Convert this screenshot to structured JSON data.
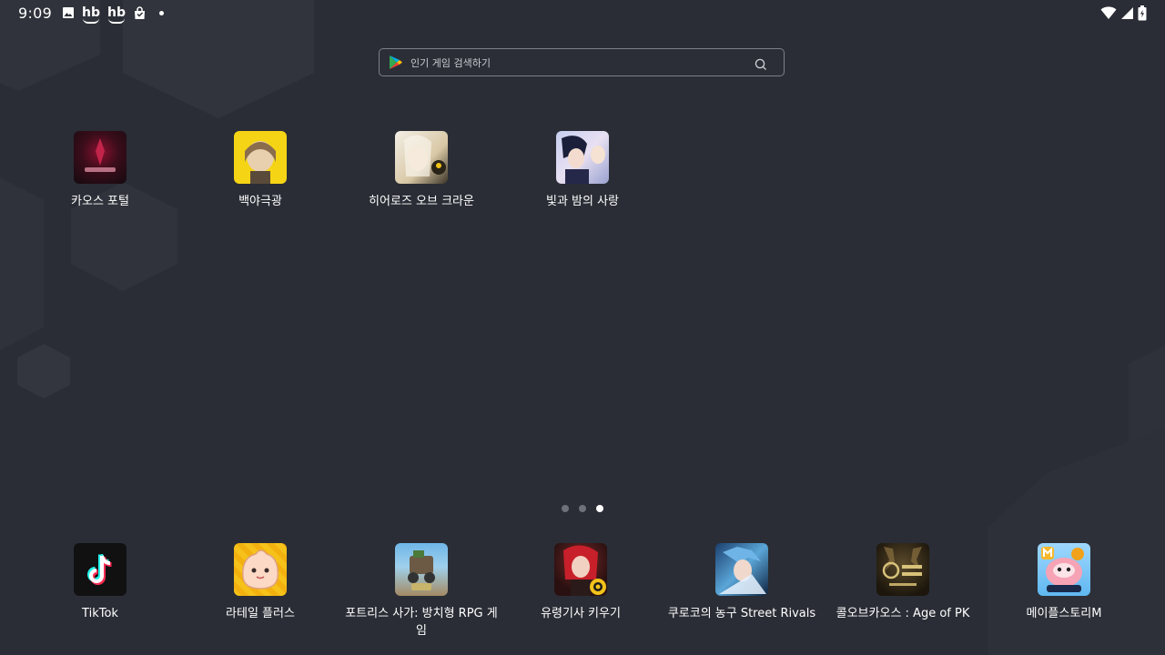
{
  "status_bar": {
    "time": "9:09",
    "notification_icons": [
      "image-icon",
      "hb-icon",
      "hb-icon",
      "shopping-bag-icon",
      "dot-icon"
    ],
    "hb_text": "hb",
    "right_icons": [
      "wifi-icon",
      "cellular-signal-icon",
      "battery-icon"
    ]
  },
  "search": {
    "placeholder": "인기 게임 검색하기",
    "value": ""
  },
  "home_apps": [
    {
      "label": "카오스 포털",
      "icon": "chaos-portal-icon"
    },
    {
      "label": "백야극광",
      "icon": "alchemy-stars-icon"
    },
    {
      "label": "히어로즈 오브 크라운",
      "icon": "heroes-of-crown-icon"
    },
    {
      "label": "빛과 밤의 사랑",
      "icon": "light-and-night-icon"
    }
  ],
  "page_indicator": {
    "pages": 3,
    "current": 3
  },
  "dock_apps": [
    {
      "label": "TikTok",
      "icon": "tiktok-icon"
    },
    {
      "label": "라테일 플러스",
      "icon": "latale-plus-icon"
    },
    {
      "label": "포트리스 사가: 방치형 RPG 게임",
      "icon": "fortress-saga-icon"
    },
    {
      "label": "유령기사 키우기",
      "icon": "ghost-knight-icon"
    },
    {
      "label": "쿠로코의 농구 Street Rivals",
      "icon": "kuroko-basketball-icon"
    },
    {
      "label": "콜오브카오스 : Age of PK",
      "icon": "call-of-chaos-icon"
    },
    {
      "label": "메이플스토리M",
      "icon": "maplestory-m-icon"
    }
  ],
  "colors": {
    "background": "#2a2d35",
    "search_border": "#7c8088",
    "dot_active": "#ffffff",
    "dot_inactive": "#6d717a"
  }
}
